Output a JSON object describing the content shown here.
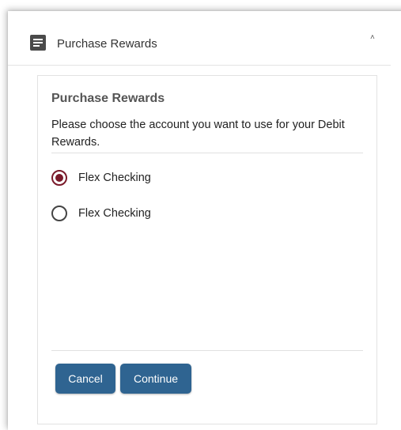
{
  "accordion": {
    "title": "Purchase Rewards",
    "icon": "document-icon",
    "collapse_icon": "caret-up-icon"
  },
  "panel": {
    "title": "Purchase Rewards",
    "description": "Please choose the account you want to use for your Debit Rewards.",
    "options": [
      {
        "label": "Flex Checking",
        "selected": true
      },
      {
        "label": "Flex Checking",
        "selected": false
      }
    ],
    "buttons": {
      "cancel_label": "Cancel",
      "continue_label": "Continue"
    }
  },
  "colors": {
    "primary_button": "#2f6491",
    "radio_selected": "#7a1a2a"
  }
}
